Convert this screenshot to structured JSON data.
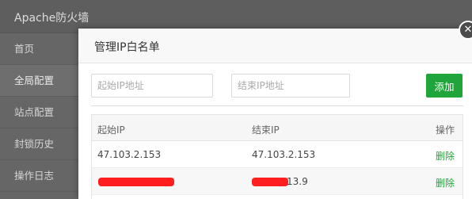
{
  "app": {
    "title": "Apache防火墙",
    "sidebar": [
      {
        "label": "首页",
        "active": false
      },
      {
        "label": "全局配置",
        "active": true
      },
      {
        "label": "站点配置",
        "active": false
      },
      {
        "label": "封锁历史",
        "active": false
      },
      {
        "label": "操作日志",
        "active": false
      }
    ]
  },
  "modal": {
    "title": "管理IP白名单",
    "close_icon": "close-icon",
    "start_placeholder": "起始IP地址",
    "end_placeholder": "结束IP地址",
    "add_label": "添加",
    "columns": [
      "起始IP",
      "结束IP",
      "操作"
    ],
    "rows": [
      {
        "start": "47.103.2.153",
        "end": "47.103.2.153",
        "action": "删除"
      },
      {
        "start": "",
        "end": "13.9",
        "action": "删除"
      }
    ]
  },
  "colors": {
    "accent": "#20a53a",
    "redaction": "#ff1f1f"
  }
}
